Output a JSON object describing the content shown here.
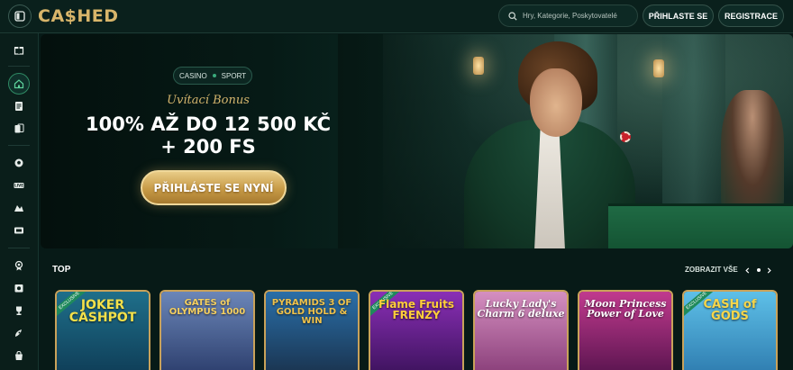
{
  "header": {
    "logo": "CA$HED",
    "search_placeholder": "Hry, Kategorie, Poskytovatelé",
    "login_label": "PŘIHLASTE SE",
    "register_label": "REGISTRACE"
  },
  "sidebar": {
    "items": [
      {
        "icon": "gift-icon"
      },
      {
        "icon": "home-icon",
        "active": true
      },
      {
        "icon": "document-icon"
      },
      {
        "icon": "cards-icon"
      },
      {
        "icon": "sport-icon"
      },
      {
        "icon": "live-icon"
      },
      {
        "icon": "esports-icon"
      },
      {
        "icon": "ticket-icon"
      },
      {
        "icon": "medal-icon"
      },
      {
        "icon": "promo-icon"
      },
      {
        "icon": "trophy-icon"
      },
      {
        "icon": "rocket-icon"
      },
      {
        "icon": "shop-icon"
      }
    ]
  },
  "hero": {
    "tab_casino": "CASINO",
    "tab_sport": "SPORT",
    "subtitle": "Uvítací Bonus",
    "headline_line1": "100% AŽ DO 12 500 KČ",
    "headline_line2": "+ 200 FS",
    "cta_label": "PŘIHLÁSTE SE NYNÍ"
  },
  "section": {
    "title": "TOP",
    "show_all": "ZOBRAZIT VŠE"
  },
  "games": [
    {
      "title": "JOKER CASHPOT",
      "badge": "EXCLUSIVE",
      "colors": [
        "#1f6f8a",
        "#0f3e58"
      ],
      "title_color": "#f3e04a"
    },
    {
      "title": "GATES of OLYMPUS 1000",
      "badge": "",
      "colors": [
        "#6b86b8",
        "#2d3f6e"
      ],
      "title_color": "#f5d060"
    },
    {
      "title": "PYRAMIDS 3 OF GOLD HOLD & WIN",
      "badge": "",
      "colors": [
        "#2a6fa8",
        "#1a3450"
      ],
      "title_color": "#f0c24a"
    },
    {
      "title": "Flame Fruits FRENZY",
      "badge": "EXCLUSIVE",
      "colors": [
        "#8a2fb6",
        "#3e135e"
      ],
      "title_color": "#ffce3a"
    },
    {
      "title": "Lucky Lady's Charm 6 deluxe",
      "badge": "",
      "colors": [
        "#d58fc0",
        "#8a3f7a"
      ],
      "title_color": "#ffffff"
    },
    {
      "title": "Moon Princess Power of Love",
      "badge": "",
      "colors": [
        "#c13a8e",
        "#5b1550"
      ],
      "title_color": "#ffffff"
    },
    {
      "title": "CASH of GODS",
      "badge": "EXCLUSIVE",
      "colors": [
        "#5ec0e8",
        "#2f7db0"
      ],
      "title_color": "#f7d64a"
    }
  ],
  "colors": {
    "accent_gold": "#d8b56a",
    "background": "#071a17",
    "active_green": "#2f8a64"
  }
}
